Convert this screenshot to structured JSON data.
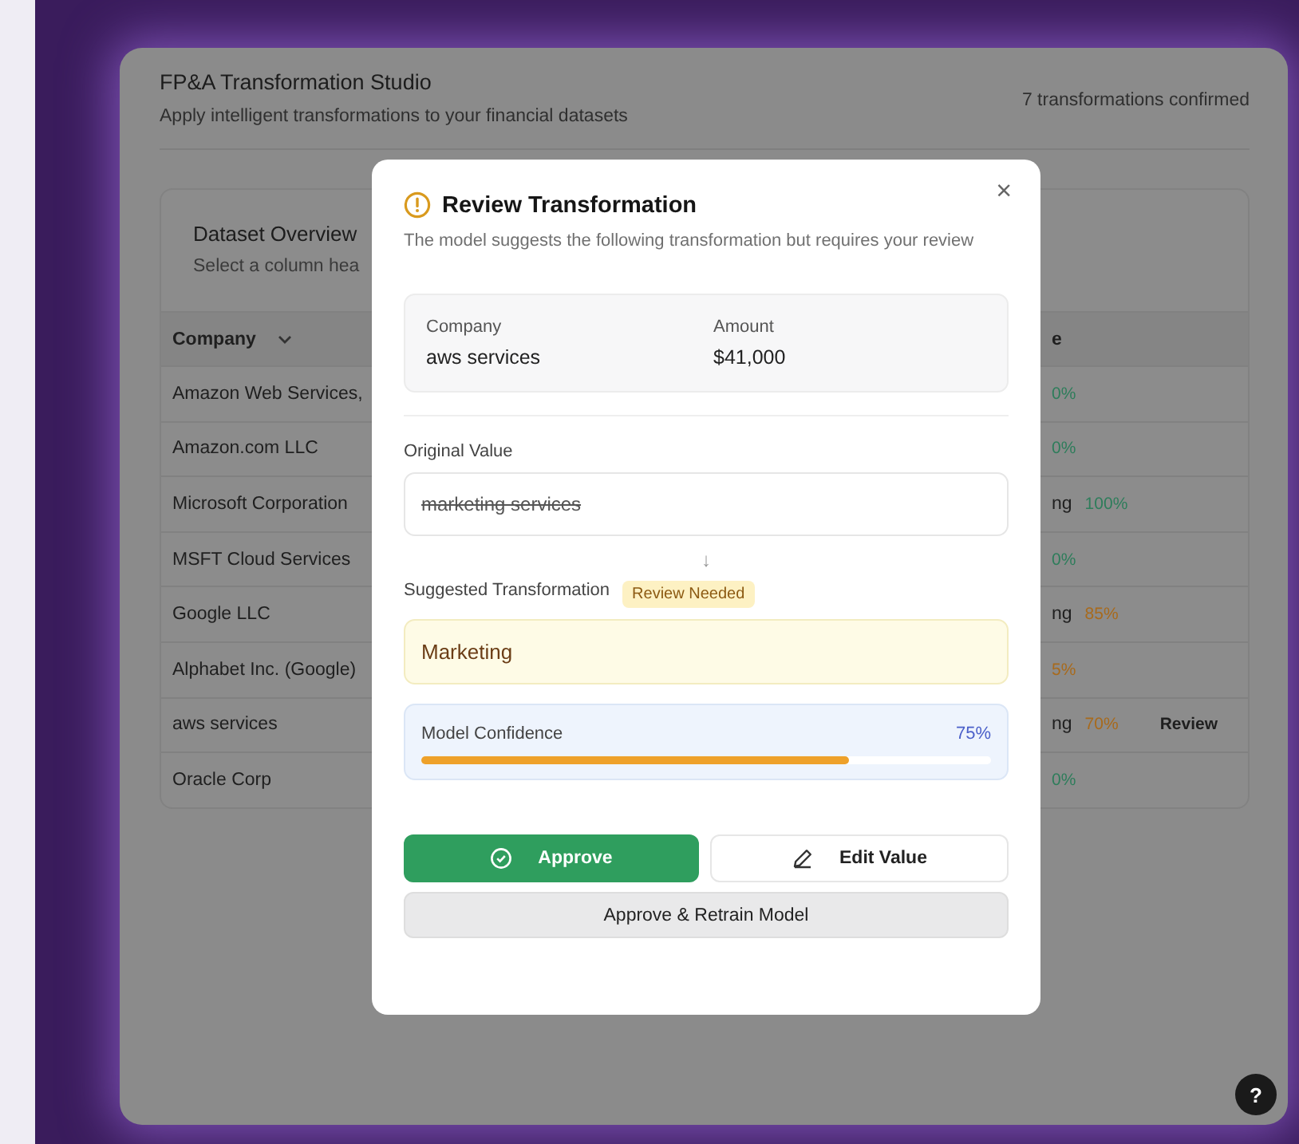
{
  "app": {
    "title": "FP&A Transformation Studio",
    "subtitle": "Apply intelligent transformations to your financial datasets",
    "status": "7 transformations confirmed"
  },
  "dataset": {
    "title": "Dataset Overview",
    "hint": "Select a column hea",
    "columns": [
      {
        "label": "Company"
      },
      {
        "label": "e"
      }
    ],
    "rows": [
      {
        "company": "Amazon Web Services,",
        "confidence": "0%",
        "color": "#2e7d5b"
      },
      {
        "company": "Amazon.com LLC",
        "confidence": "0%",
        "color": "#2e7d5b"
      },
      {
        "company": "Microsoft Corporation",
        "status": "ng",
        "confidence": "100%",
        "color": "#2e7d5b"
      },
      {
        "company": "MSFT Cloud Services",
        "confidence": "0%",
        "color": "#2e7d5b"
      },
      {
        "company": "Google LLC",
        "status": "ng",
        "confidence": "85%",
        "color": "#a86a1c"
      },
      {
        "company": "Alphabet Inc. (Google)",
        "confidence": "5%",
        "color": "#a86a1c"
      },
      {
        "company": "aws services",
        "status": "ng",
        "confidence": "70%",
        "color": "#a86a1c",
        "action": "Review"
      },
      {
        "company": "Oracle Corp",
        "confidence": "0%",
        "color": "#2e7d5b"
      }
    ]
  },
  "modal": {
    "title": "Review Transformation",
    "description": "The model suggests the following transformation but requires your review",
    "close": "×",
    "record": [
      {
        "label": "Company",
        "value": "aws services"
      },
      {
        "label": "Amount",
        "value": "$41,000"
      }
    ],
    "original_label": "Original Value",
    "original_value": "marketing services",
    "arrow": "↓",
    "suggested_label": "Suggested Transformation",
    "badge": "Review Needed",
    "suggested_value": "Marketing",
    "confidence": {
      "label": "Model Confidence",
      "reading": "75%",
      "level": 0.75
    },
    "buttons": [
      {
        "kind": "approve",
        "label": "Approve"
      },
      {
        "kind": "edit",
        "label": "Edit Value"
      },
      {
        "kind": "retrain",
        "label": "Approve & Retrain Model"
      }
    ]
  },
  "help": "?"
}
